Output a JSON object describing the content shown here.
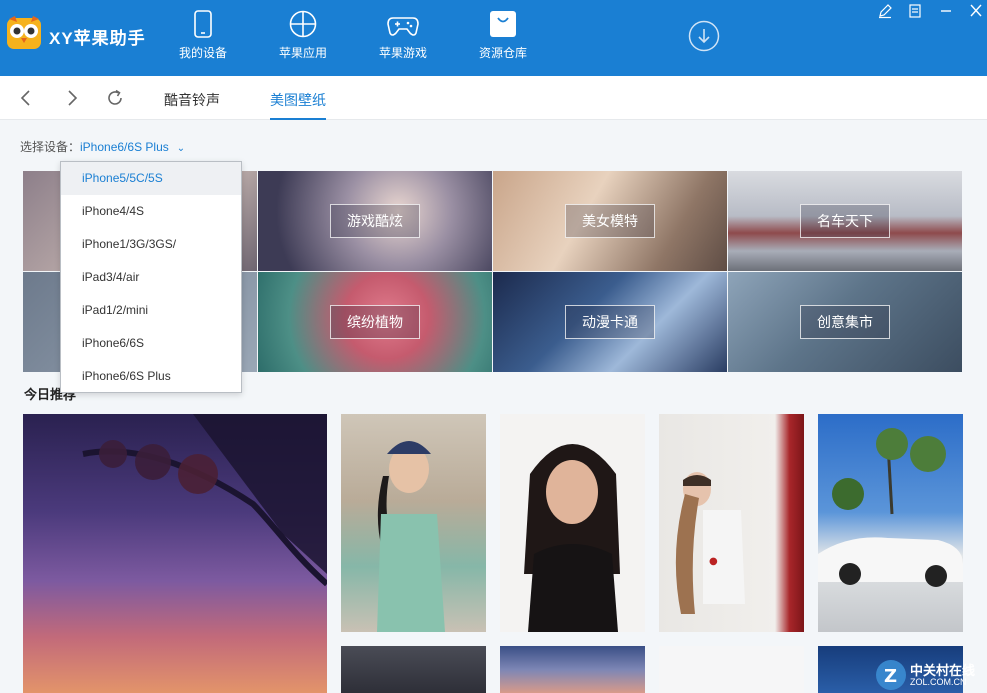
{
  "app": {
    "title": "XY苹果助手",
    "accent": "#1a7fd3"
  },
  "nav": {
    "items": [
      {
        "label": "我的设备",
        "icon": "phone-icon"
      },
      {
        "label": "苹果应用",
        "icon": "apps-icon"
      },
      {
        "label": "苹果游戏",
        "icon": "gamepad-icon"
      },
      {
        "label": "资源仓库",
        "icon": "shopping-bag-icon"
      }
    ],
    "active": "资源仓库"
  },
  "tabs": {
    "items": [
      "酷音铃声",
      "美图壁纸"
    ],
    "active": "美图壁纸"
  },
  "device": {
    "label": "选择设备：",
    "value": "iPhone6/6S Plus",
    "options": [
      "iPhone5/5C/5S",
      "iPhone4/4S",
      "iPhone1/3G/3GS/",
      "iPad3/4/air",
      "iPad1/2/mini",
      "iPhone6/6S",
      "iPhone6/6S Plus"
    ],
    "highlighted": "iPhone5/5C/5S"
  },
  "categories": [
    {
      "label": "游戏酷炫"
    },
    {
      "label": "美女模特"
    },
    {
      "label": "名车天下"
    },
    {
      "label": "缤纷植物"
    },
    {
      "label": "动漫卡通"
    },
    {
      "label": "创意集市"
    }
  ],
  "recommend": {
    "title": "今日推荐"
  },
  "watermark": {
    "text": "中关村在线",
    "sub": "ZOL.COM.CN"
  }
}
